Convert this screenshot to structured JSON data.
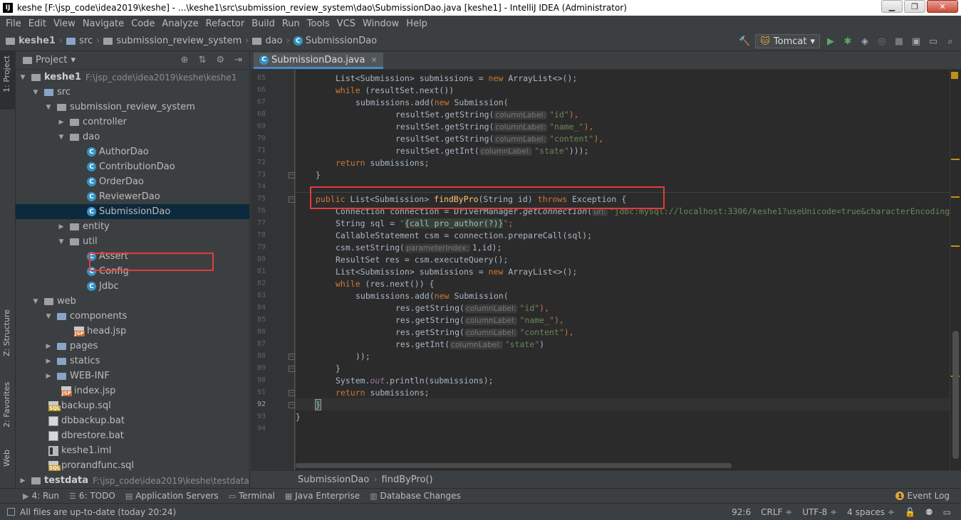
{
  "window": {
    "title": "keshe [F:\\jsp_code\\idea2019\\keshe] - ...\\keshe1\\src\\submission_review_system\\dao\\SubmissionDao.java [keshe1] - IntelliJ IDEA (Administrator)",
    "min_icon": "minimize-icon",
    "restore_icon": "restore-icon",
    "close_icon": "close-icon"
  },
  "menu": [
    "File",
    "Edit",
    "View",
    "Navigate",
    "Code",
    "Analyze",
    "Refactor",
    "Build",
    "Run",
    "Tools",
    "VCS",
    "Window",
    "Help"
  ],
  "breadcrumb": [
    "keshe1",
    "src",
    "submission_review_system",
    "dao",
    "SubmissionDao"
  ],
  "run_config": "Tomcat",
  "side_tabs": {
    "project": "1: Project",
    "structure": "Z: Structure",
    "favorites": "2: Favorites",
    "web": "Web"
  },
  "project_panel": {
    "title": "Project",
    "tree": [
      {
        "label": "keshe1",
        "path": "F:\\jsp_code\\idea2019\\keshe\\keshe1",
        "icon": "module-folder",
        "bold": true
      },
      {
        "label": "src",
        "icon": "source-folder"
      },
      {
        "label": "submission_review_system",
        "icon": "package"
      },
      {
        "label": "controller",
        "icon": "package"
      },
      {
        "label": "dao",
        "icon": "package"
      },
      {
        "label": "AuthorDao",
        "icon": "class"
      },
      {
        "label": "ContributionDao",
        "icon": "class"
      },
      {
        "label": "OrderDao",
        "icon": "class"
      },
      {
        "label": "ReviewerDao",
        "icon": "class"
      },
      {
        "label": "SubmissionDao",
        "icon": "class",
        "selected": true
      },
      {
        "label": "entity",
        "icon": "package"
      },
      {
        "label": "util",
        "icon": "package"
      },
      {
        "label": "Assert",
        "icon": "class"
      },
      {
        "label": "Config",
        "icon": "class"
      },
      {
        "label": "Jdbc",
        "icon": "class"
      },
      {
        "label": "web",
        "icon": "web-folder"
      },
      {
        "label": "components",
        "icon": "folder"
      },
      {
        "label": "head.jsp",
        "icon": "jsp"
      },
      {
        "label": "pages",
        "icon": "folder"
      },
      {
        "label": "statics",
        "icon": "folder"
      },
      {
        "label": "WEB-INF",
        "icon": "folder"
      },
      {
        "label": "index.jsp",
        "icon": "jsp"
      },
      {
        "label": "backup.sql",
        "icon": "sql"
      },
      {
        "label": "dbbackup.bat",
        "icon": "bat"
      },
      {
        "label": "dbrestore.bat",
        "icon": "bat"
      },
      {
        "label": "keshe1.iml",
        "icon": "iml"
      },
      {
        "label": "prorandfunc.sql",
        "icon": "sql"
      },
      {
        "label": "testdata",
        "path": "F:\\jsp_code\\idea2019\\keshe\\testdata",
        "icon": "module-folder",
        "bold": true
      }
    ]
  },
  "editor": {
    "tab": "SubmissionDao.java",
    "line_numbers": [
      "65",
      "66",
      "67",
      "68",
      "69",
      "70",
      "71",
      "72",
      "73",
      "74",
      "75",
      "76",
      "77",
      "78",
      "79",
      "80",
      "81",
      "82",
      "83",
      "84",
      "85",
      "86",
      "87",
      "88",
      "89",
      "90",
      "91",
      "92",
      "93",
      "94"
    ],
    "hint_columnLabel": "columnLabel:",
    "hint_url": "url:",
    "hint_parameterIndex": "parameterIndex:",
    "code": {
      "l65a": "List<Submission> submissions = ",
      "l65b": "new",
      "l65c": " ArrayList<>();",
      "l66a": "while",
      "l66b": " (resultSet.next())",
      "l67a": "submissions.add(",
      "l67b": "new",
      "l67c": " Submission(",
      "l68a": "resultSet.getString(",
      "l68s": "\"id\"",
      "l68b": "),",
      "l69a": "resultSet.getString(",
      "l69s": "\"name_\"",
      "l69b": "),",
      "l70a": "resultSet.getString(",
      "l70s": "\"content\"",
      "l70b": "),",
      "l71a": "resultSet.getInt(",
      "l71s": "\"state\"",
      "l71b": ")));",
      "l72a": "return",
      "l72b": " submissions;",
      "l73": "}",
      "l75a": "public",
      "l75b": " List<Submission> ",
      "l75c": "findByPro",
      "l75d": "(String id) ",
      "l75e": "throws",
      "l75f": " Exception {",
      "l76a": "Connection connection = DriverManager.",
      "l76b": "getConnection",
      "l76c": "(",
      "l76s": "\"jdbc:mysql://localhost:3306/keshe1?useUnicode=true&characterEncoding",
      "l77a": "String sql = ",
      "l77s1": "\"",
      "l77inj": "{call pro_author(?)}",
      "l77s2": "\"",
      "l77b": ";",
      "l78": "CallableStatement csm = connection.prepareCall(sql);",
      "l79a": "csm.setString(",
      "l79b": "1,id);",
      "l80": "ResultSet res = csm.executeQuery();",
      "l81a": "List<Submission> submissions = ",
      "l81b": "new",
      "l81c": " ArrayList<>();",
      "l82a": "while",
      "l82b": " (res.next()) {",
      "l83a": "submissions.add(",
      "l83b": "new",
      "l83c": " Submission(",
      "l84a": "res.getString(",
      "l84s": "\"id\"",
      "l84b": "),",
      "l85a": "res.getString(",
      "l85s": "\"name_\"",
      "l85b": "),",
      "l86a": "res.getString(",
      "l86s": "\"content\"",
      "l86b": "),",
      "l87a": "res.getInt(",
      "l87s": "\"state\"",
      "l87b": ")",
      "l88": "));",
      "l89": "}",
      "l90a": "System.",
      "l90b": "out",
      "l90c": ".println(submissions);",
      "l91a": "return",
      "l91b": " submissions;",
      "l92": "}",
      "l93": "}"
    },
    "bottom_crumbs": [
      "SubmissionDao",
      "findByPro()"
    ]
  },
  "tool_windows": [
    {
      "label": "4: Run",
      "icon": "run-icon"
    },
    {
      "label": "6: TODO",
      "icon": "todo-icon"
    },
    {
      "label": "Application Servers",
      "icon": "server-icon"
    },
    {
      "label": "Terminal",
      "icon": "terminal-icon"
    },
    {
      "label": "Java Enterprise",
      "icon": "java-enterprise-icon"
    },
    {
      "label": "Database Changes",
      "icon": "database-icon"
    }
  ],
  "event_log": {
    "label": "Event Log",
    "count": "1"
  },
  "status": {
    "message": "All files are up-to-date (today 20:24)",
    "position": "92:6",
    "line_sep": "CRLF ÷",
    "encoding": "UTF-8 ÷",
    "indent": "4 spaces ÷"
  },
  "colors": {
    "keyword": "#cc7832",
    "string": "#6a8759",
    "method": "#ffc66d",
    "highlight_box": "#e33b3b"
  }
}
